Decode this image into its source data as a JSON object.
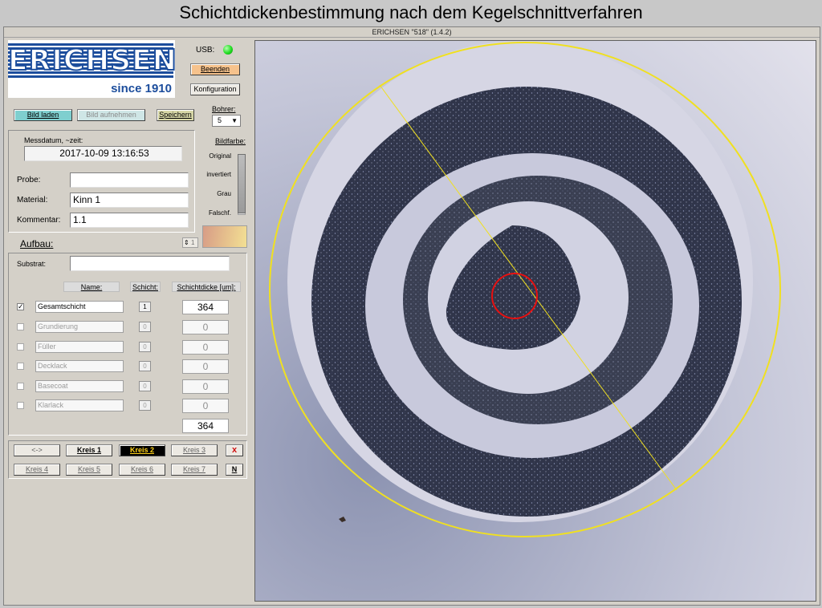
{
  "page_title": "Schichtdickenbestimmung nach dem Kegelschnittverfahren",
  "window_title": "ERICHSEN \"518\" (1.4.2)",
  "logo": {
    "brand": "ERICHSEN",
    "tagline": "since 1910",
    "brand_color": "#1c4d9c"
  },
  "usb": {
    "label": "USB:",
    "status_color": "#22dd22"
  },
  "buttons": {
    "beenden": "Beenden",
    "konfiguration": "Konfiguration",
    "bild_laden": "Bild laden",
    "bild_aufnehmen": "Bild aufnehmen",
    "speichern": "Speichern"
  },
  "bohrer": {
    "label": "Bohrer:",
    "value": "5"
  },
  "bildfarbe": {
    "label": "Bildfarbe:",
    "options": [
      "Original",
      "invertiert",
      "Grau",
      "Falschf."
    ],
    "selected": "Original"
  },
  "info": {
    "date_label": "Messdatum, ~zeit:",
    "date_value": "2017-10-09 13:16:53",
    "probe_label": "Probe:",
    "probe_value": "",
    "material_label": "Material:",
    "material_value": "Kinn 1",
    "kommentar_label": "Kommentar:",
    "kommentar_value": "1.1"
  },
  "aufbau": {
    "label": "Aufbau:",
    "spin_value": "1",
    "substrat_label": "Substrat:",
    "substrat_value": "",
    "col_name": "Name:",
    "col_schicht": "Schicht:",
    "col_dicke": "Schichtdicke [um]:",
    "rows": [
      {
        "checked": true,
        "name": "Gesamtschicht",
        "schicht": "1",
        "dicke": "364"
      },
      {
        "checked": false,
        "name": "Grundierung",
        "schicht": "0",
        "dicke": "0"
      },
      {
        "checked": false,
        "name": "Füller",
        "schicht": "0",
        "dicke": "0"
      },
      {
        "checked": false,
        "name": "Decklack",
        "schicht": "0",
        "dicke": "0"
      },
      {
        "checked": false,
        "name": "Basecoat",
        "schicht": "0",
        "dicke": "0"
      },
      {
        "checked": false,
        "name": "Klarlack",
        "schicht": "0",
        "dicke": "0"
      }
    ],
    "total": "364",
    "check_mark": "✓"
  },
  "kreis": {
    "arrows": "<->",
    "k1": "Kreis 1",
    "k2": "Kreis 2",
    "k3": "Kreis 3",
    "k4": "Kreis 4",
    "k5": "Kreis 5",
    "k6": "Kreis 6",
    "k7": "Kreis 7",
    "close": "x",
    "n": "N"
  }
}
